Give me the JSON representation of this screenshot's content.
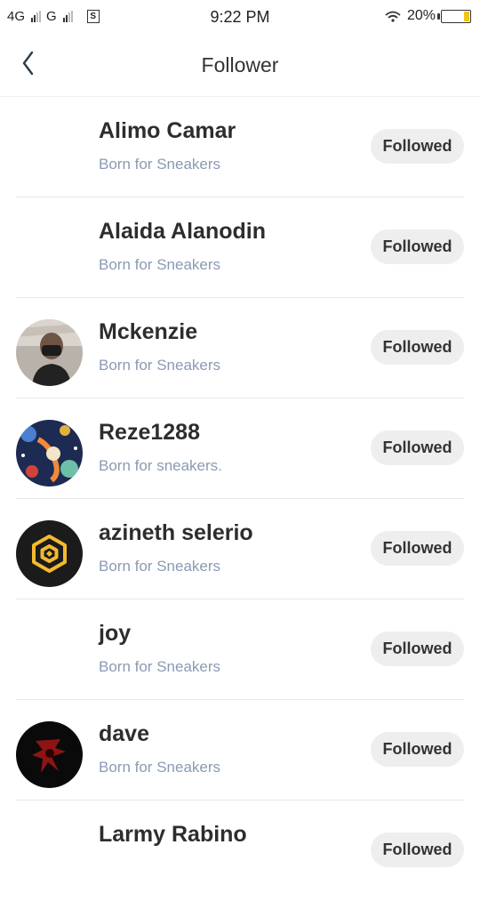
{
  "status_bar": {
    "network1": "4G",
    "network2": "G",
    "time": "9:22 PM",
    "battery": "20%",
    "battery_level": 0.2,
    "battery_color": "#f0c419"
  },
  "header": {
    "title": "Follower",
    "back_icon": "chevron-left-icon"
  },
  "colors": {
    "bio": "#8a9ab3",
    "button_bg": "#eeeeee"
  },
  "followers": [
    {
      "name": "Alimo Camar",
      "bio": "Born for Sneakers",
      "button": "Followed",
      "avatar": "none"
    },
    {
      "name": "Alaida Alanodin",
      "bio": "Born for Sneakers",
      "button": "Followed",
      "avatar": "none"
    },
    {
      "name": "Mckenzie",
      "bio": "Born for Sneakers",
      "button": "Followed",
      "avatar": "photo-masked-person"
    },
    {
      "name": "Reze1288",
      "bio": "Born for sneakers.",
      "button": "Followed",
      "avatar": "illustration-space"
    },
    {
      "name": "azineth selerio",
      "bio": "Born for Sneakers",
      "button": "Followed",
      "avatar": "binance-logo"
    },
    {
      "name": "joy",
      "bio": "Born for Sneakers",
      "button": "Followed",
      "avatar": "none"
    },
    {
      "name": "dave",
      "bio": "Born for Sneakers",
      "button": "Followed",
      "avatar": "dark-red-emblem"
    },
    {
      "name": "Larmy Rabino",
      "bio": "",
      "button": "Followed",
      "avatar": "none"
    }
  ]
}
